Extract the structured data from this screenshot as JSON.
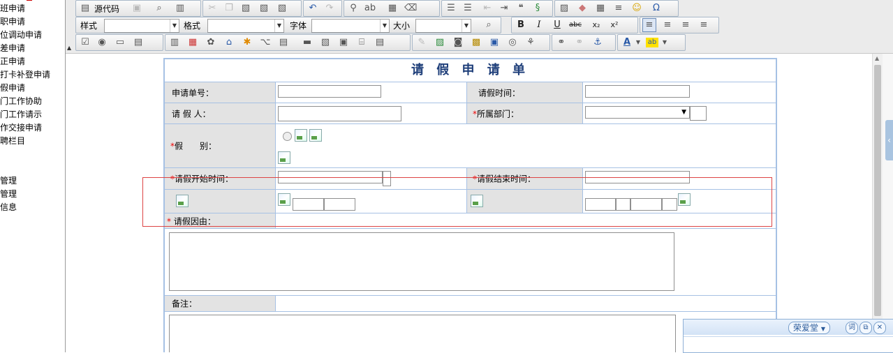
{
  "left_nav": [
    "班申请",
    "职申请",
    "位调动申请",
    "差申请",
    "正申请",
    "打卡补登申请",
    "假申请",
    "门工作协助",
    "门工作请示",
    "作交接申请",
    "聘栏目",
    "管理",
    "管理",
    "信息"
  ],
  "toolbar": {
    "source_label": "源代码",
    "style_label": "样式",
    "format_label": "格式",
    "font_label": "字体",
    "size_label": "大小",
    "bold": "B",
    "italic": "I",
    "underline": "U",
    "strike": "abc",
    "subscript": "x₂",
    "superscript": "x²",
    "omega": "Ω",
    "textcolor": "A",
    "bgcolor": "ab"
  },
  "form": {
    "title": "请 假 申 请 单",
    "app_no_label": "申请单号：",
    "leave_time_label": "请假时间：",
    "applicant_label": "请 假 人：",
    "dept_label": "所属部门：",
    "dept_arrow": "▼",
    "leave_type_label": "假　　别：",
    "start_label": "请假开始时间：",
    "end_label": "请假结束时间：",
    "reason_label": "请假因由：",
    "remark_label": "备注：",
    "required_mark": "*"
  },
  "ime": {
    "name": "荣爱堂",
    "btn_ci": "词",
    "btn_copy": "⧉",
    "btn_close": "✕"
  },
  "sidetab": "‹",
  "colors": {
    "table_border": "#a6c1e4",
    "label_bg": "#e3e3e3",
    "title_color": "#1f3f7a",
    "required": "#e00000",
    "highlight_box": "#d44444"
  }
}
